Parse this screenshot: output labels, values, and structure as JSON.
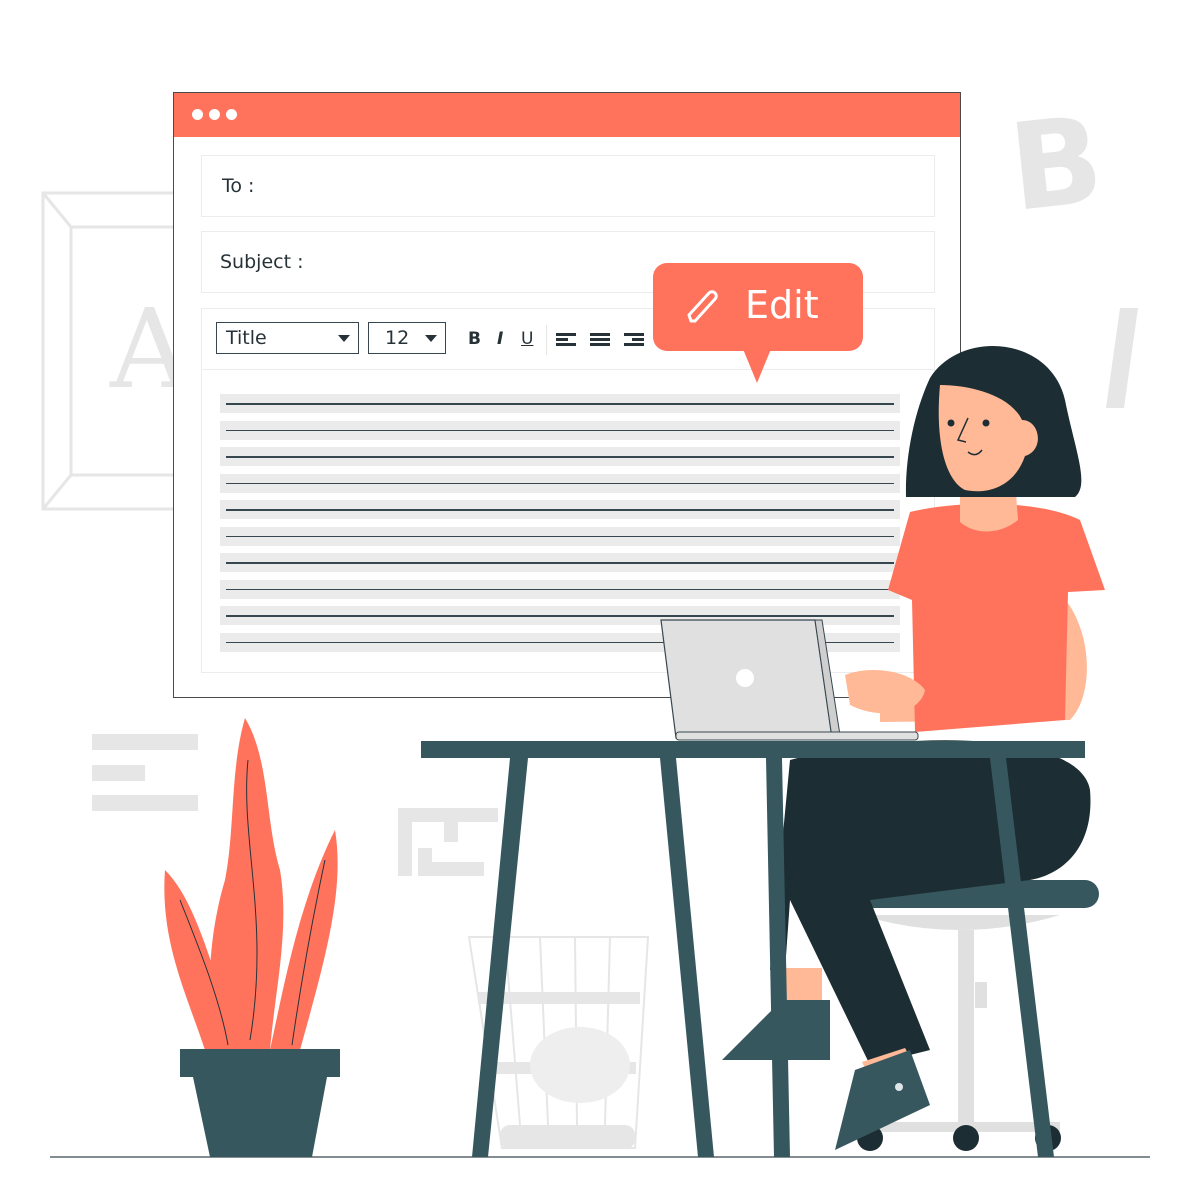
{
  "window": {
    "titlebar_dots": 3,
    "fields": {
      "to_label": "To :",
      "subject_label": "Subject :"
    },
    "toolbar": {
      "style_select_value": "Title",
      "size_select_value": "12",
      "bold_label": "B",
      "italic_label": "I",
      "underline_label": "U",
      "align_left_icon": "align-left-icon",
      "align_center_icon": "align-justify-icon",
      "align_right_icon": "align-right-icon"
    },
    "body_line_count": 10
  },
  "edit_bubble": {
    "label": "Edit",
    "icon": "pencil-icon"
  },
  "background": {
    "letter_a": "A",
    "letter_b": "B",
    "slash": "/"
  },
  "colors": {
    "accent": "#ff735c",
    "dark": "#263238",
    "furniture": "#37575f",
    "skin": "#ffb996",
    "light_gray": "#e6e6e6"
  }
}
